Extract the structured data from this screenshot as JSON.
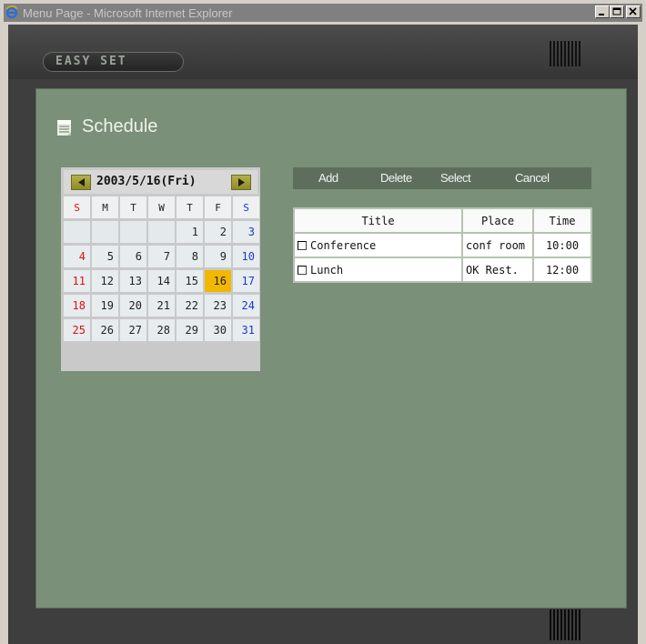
{
  "window": {
    "title": "Menu Page - Microsoft Internet Explorer"
  },
  "app": {
    "logo": "EASY SET"
  },
  "page": {
    "heading": "Schedule"
  },
  "calendar": {
    "date_label": "2003/5/16(Fri)",
    "weekdays": [
      "S",
      "M",
      "T",
      "W",
      "T",
      "F",
      "S"
    ],
    "weeks": [
      [
        "",
        "",
        "",
        "",
        "1",
        "2",
        "3"
      ],
      [
        "4",
        "5",
        "6",
        "7",
        "8",
        "9",
        "10"
      ],
      [
        "11",
        "12",
        "13",
        "14",
        "15",
        "16",
        "17"
      ],
      [
        "18",
        "19",
        "20",
        "21",
        "22",
        "23",
        "24"
      ],
      [
        "25",
        "26",
        "27",
        "28",
        "29",
        "30",
        "31"
      ]
    ],
    "selected_day": "16",
    "colors": {
      "sunday": "#e01010",
      "saturday": "#1a3ad0",
      "selected": "#f2b700"
    }
  },
  "actions": {
    "add": "Add",
    "delete": "Delete",
    "select": "Select",
    "cancel": "Cancel"
  },
  "schedule_table": {
    "columns": [
      "Title",
      "Place",
      "Time"
    ],
    "rows": [
      {
        "title": "Conference",
        "place": "conf room",
        "time": "10:00",
        "checked": false
      },
      {
        "title": "Lunch",
        "place": "OK Rest.",
        "time": "12:00",
        "checked": false
      }
    ]
  },
  "colors": {
    "panel": "#7a9078",
    "frame": "#3e3e3e",
    "action_bar": "#5e6e5c"
  }
}
